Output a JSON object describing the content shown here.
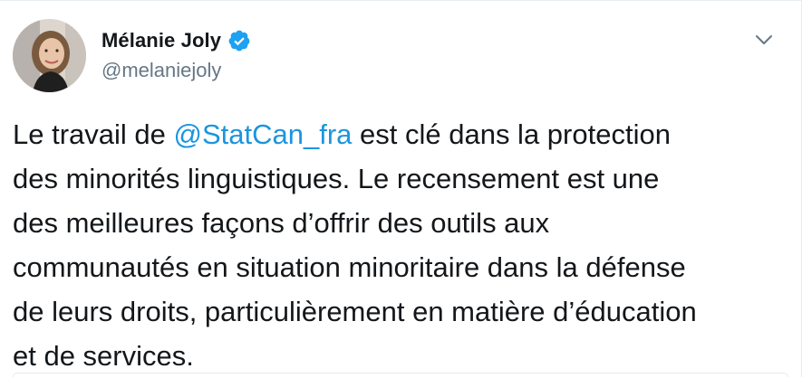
{
  "author": {
    "display_name": "Mélanie Joly",
    "handle": "@melaniejoly",
    "verified": true,
    "avatar_icon": "profile-photo",
    "verified_icon": "verified-badge-icon",
    "verified_color": "#1da1f2"
  },
  "menu": {
    "icon": "chevron-down-icon"
  },
  "tweet": {
    "text_before": "Le travail de ",
    "mention": "@StatCan_fra",
    "text_after": " est clé dans la protection\ndes minorités linguistiques. Le recensement est une\ndes meilleures façons d’offrir des outils aux\ncommunautés en situation minoritaire dans la défense\nde leurs droits, particulièrement en matière d’éducation\net de services."
  },
  "colors": {
    "text": "#14171a",
    "secondary_text": "#657786",
    "link": "#1b95e0",
    "border": "#e6ecf0"
  }
}
